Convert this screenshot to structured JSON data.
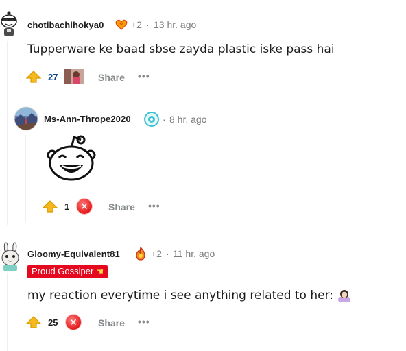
{
  "comments": [
    {
      "username": "chotibachihokya0",
      "award_count": "+2",
      "separator": "·",
      "time": "13 hr. ago",
      "body": "Tupperware ke baad sbse zayda plastic iske pass hai",
      "votes": "27",
      "share_label": "Share",
      "more_label": "•••"
    },
    {
      "username": "Ms-Ann-Thrope2020",
      "separator": "·",
      "time": "8 hr. ago",
      "votes": "1",
      "share_label": "Share",
      "more_label": "•••"
    },
    {
      "username": "Gloomy-Equivalent81",
      "award_count": "+2",
      "separator": "·",
      "time": "11 hr. ago",
      "flair": "Proud Gossiper",
      "body": "my reaction everytime i see anything related to her:",
      "votes": "25",
      "share_label": "Share",
      "more_label": "•••"
    }
  ],
  "colors": {
    "flair_bg": "#e5091f",
    "upvote_arrow": "#f5b91e",
    "vote_blue": "#0d4b8a",
    "muted": "#7c7c7c"
  },
  "icons": {
    "avatar_1": "snoo-avatar-sunglasses-icon",
    "avatar_2": "landscape-avatar-icon",
    "avatar_3": "bunny-avatar-icon",
    "award_heart": "heart-award-icon",
    "award_aqua": "aqua-award-icon",
    "award_fire": "fire-award-icon",
    "upvote": "upvote-arrow-icon",
    "downvote_award": "x-award-icon",
    "snoo_laugh": "laughing-snoo-emote",
    "person_emoji": "person-shrugging-emoji",
    "flair_emoji": "pointing-hand-emoji"
  }
}
